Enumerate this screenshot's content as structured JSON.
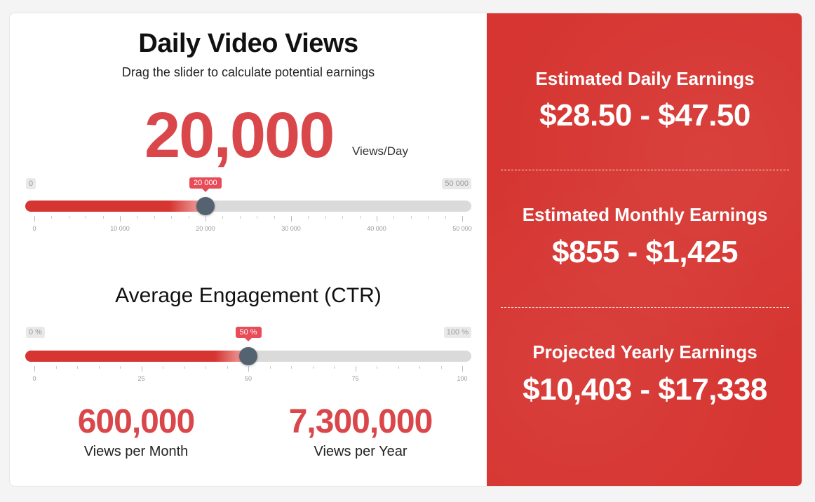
{
  "views": {
    "title": "Daily Video Views",
    "subtitle": "Drag the slider to calculate potential earnings",
    "value": "20,000",
    "unit": "Views/Day",
    "slider": {
      "min_label": "0",
      "max_label": "50 000",
      "bubble": "20 000",
      "value": 20000,
      "min": 0,
      "max": 50000,
      "tick_labels": [
        "0",
        "10 000",
        "20 000",
        "30 000",
        "40 000",
        "50 000"
      ]
    }
  },
  "engagement": {
    "title": "Average Engagement (CTR)",
    "slider": {
      "min_label": "0 %",
      "max_label": "100 %",
      "bubble": "50 %",
      "value": 50,
      "min": 0,
      "max": 100,
      "tick_labels": [
        "0",
        "25",
        "50",
        "75",
        "100"
      ]
    }
  },
  "stats": {
    "monthly_value": "600,000",
    "monthly_label": "Views per Month",
    "yearly_value": "7,300,000",
    "yearly_label": "Views per Year"
  },
  "earnings": {
    "daily_title": "Estimated Daily Earnings",
    "daily_value": "$28.50 - $47.50",
    "monthly_title": "Estimated Monthly Earnings",
    "monthly_value": "$855 - $1,425",
    "yearly_title": "Projected Yearly Earnings",
    "yearly_value": "$10,403 - $17,338"
  },
  "colors": {
    "accent": "#d9474b",
    "panel": "#d63531",
    "handle": "#556270",
    "bubble": "#e74c58"
  }
}
